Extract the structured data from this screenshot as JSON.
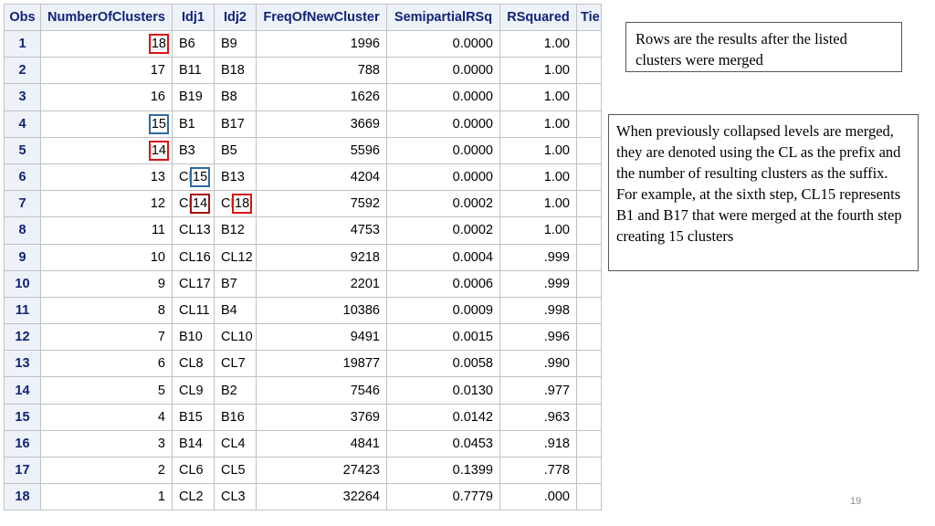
{
  "table": {
    "headers": [
      "Obs",
      "NumberOfClusters",
      "Idj1",
      "Idj2",
      "FreqOfNewCluster",
      "SemipartialRSq",
      "RSquared",
      "Tie"
    ],
    "rows": [
      {
        "obs": "1",
        "nc": "18",
        "idj1": "B6",
        "idj2": "B9",
        "freq": "1996",
        "sprsq": "0.0000",
        "rsq": "1.00"
      },
      {
        "obs": "2",
        "nc": "17",
        "idj1": "B11",
        "idj2": "B18",
        "freq": "788",
        "sprsq": "0.0000",
        "rsq": "1.00"
      },
      {
        "obs": "3",
        "nc": "16",
        "idj1": "B19",
        "idj2": "B8",
        "freq": "1626",
        "sprsq": "0.0000",
        "rsq": "1.00"
      },
      {
        "obs": "4",
        "nc": "15",
        "idj1": "B1",
        "idj2": "B17",
        "freq": "3669",
        "sprsq": "0.0000",
        "rsq": "1.00"
      },
      {
        "obs": "5",
        "nc": "14",
        "idj1": "B3",
        "idj2": "B5",
        "freq": "5596",
        "sprsq": "0.0000",
        "rsq": "1.00"
      },
      {
        "obs": "6",
        "nc": "13",
        "idj1": "CL15",
        "idj2": "B13",
        "freq": "4204",
        "sprsq": "0.0000",
        "rsq": "1.00"
      },
      {
        "obs": "7",
        "nc": "12",
        "idj1": "CL14",
        "idj2": "CL18",
        "freq": "7592",
        "sprsq": "0.0002",
        "rsq": "1.00"
      },
      {
        "obs": "8",
        "nc": "11",
        "idj1": "CL13",
        "idj2": "B12",
        "freq": "4753",
        "sprsq": "0.0002",
        "rsq": "1.00"
      },
      {
        "obs": "9",
        "nc": "10",
        "idj1": "CL16",
        "idj2": "CL12",
        "freq": "9218",
        "sprsq": "0.0004",
        "rsq": ".999"
      },
      {
        "obs": "10",
        "nc": "9",
        "idj1": "CL17",
        "idj2": "B7",
        "freq": "2201",
        "sprsq": "0.0006",
        "rsq": ".999"
      },
      {
        "obs": "11",
        "nc": "8",
        "idj1": "CL11",
        "idj2": "B4",
        "freq": "10386",
        "sprsq": "0.0009",
        "rsq": ".998"
      },
      {
        "obs": "12",
        "nc": "7",
        "idj1": "B10",
        "idj2": "CL10",
        "freq": "9491",
        "sprsq": "0.0015",
        "rsq": ".996"
      },
      {
        "obs": "13",
        "nc": "6",
        "idj1": "CL8",
        "idj2": "CL7",
        "freq": "19877",
        "sprsq": "0.0058",
        "rsq": ".990"
      },
      {
        "obs": "14",
        "nc": "5",
        "idj1": "CL9",
        "idj2": "B2",
        "freq": "7546",
        "sprsq": "0.0130",
        "rsq": ".977"
      },
      {
        "obs": "15",
        "nc": "4",
        "idj1": "B15",
        "idj2": "B16",
        "freq": "3769",
        "sprsq": "0.0142",
        "rsq": ".963"
      },
      {
        "obs": "16",
        "nc": "3",
        "idj1": "B14",
        "idj2": "CL4",
        "freq": "4841",
        "sprsq": "0.0453",
        "rsq": ".918"
      },
      {
        "obs": "17",
        "nc": "2",
        "idj1": "CL6",
        "idj2": "CL5",
        "freq": "27423",
        "sprsq": "0.1399",
        "rsq": ".778"
      },
      {
        "obs": "18",
        "nc": "1",
        "idj1": "CL2",
        "idj2": "CL3",
        "freq": "32264",
        "sprsq": "0.7779",
        "rsq": ".000"
      }
    ],
    "highlights": [
      {
        "row": 0,
        "field": "nc",
        "color": "#dd1111",
        "prefix": ""
      },
      {
        "row": 3,
        "field": "nc",
        "color": "#2e6aa0",
        "prefix": ""
      },
      {
        "row": 4,
        "field": "nc",
        "color": "#dd1111",
        "prefix": ""
      },
      {
        "row": 5,
        "field": "idj1",
        "color": "#2e6aa0",
        "prefix": "CL"
      },
      {
        "row": 6,
        "field": "idj1",
        "color": "#a51010",
        "prefix": "CL"
      },
      {
        "row": 6,
        "field": "idj2",
        "color": "#dd1111",
        "prefix": "CL"
      }
    ]
  },
  "notes": {
    "top": "Rows are the results after the listed clusters were merged",
    "main": "When previously collapsed levels are merged, they are denoted using the CL as the prefix and the number of resulting clusters as the suffix. For example, at the sixth step, CL15 represents B1 and B17 that were merged at the fourth step creating 15 clusters"
  },
  "page_number": "19"
}
